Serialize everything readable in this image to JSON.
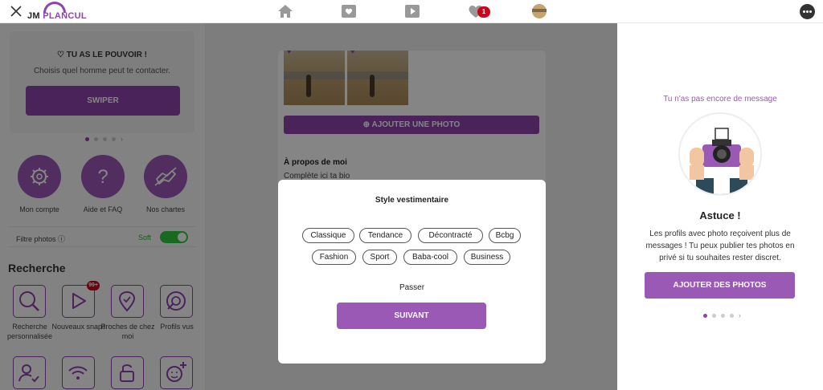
{
  "app": {
    "logo_prefix": "JM",
    "logo_suffix": "PLANCUL",
    "notifications_count": "1"
  },
  "icons": {
    "close": "close-icon",
    "home": "home-icon",
    "cards": "cards-heart-icon",
    "video": "play-icon",
    "likes": "heart-icon",
    "profile": "avatar-icon",
    "chat": "chat-bubble-icon"
  },
  "colors": {
    "brand_purple": "#8e44ad",
    "button_purple": "#9b59b6",
    "toggle_green": "#2ecc40",
    "badge_red": "#d0021b"
  },
  "sidebar": {
    "promo": {
      "title": "TU AS LE POUVOIR !",
      "subtitle": "Choisis quel homme peut te contacter.",
      "button": "SWIPER"
    },
    "quick_actions": [
      {
        "label": "Mon compte",
        "icon": "gear-icon"
      },
      {
        "label": "Aide et FAQ",
        "icon": "question-icon"
      },
      {
        "label": "Nos chartes",
        "icon": "handshake-icon"
      }
    ],
    "filter": {
      "label": "Filtre photos",
      "value": "Soft",
      "enabled": true
    },
    "search": {
      "title": "Recherche",
      "snaps_badge": "99+",
      "items": [
        {
          "label": "Recherche personnalisée",
          "icon": "search-icon"
        },
        {
          "label": "Nouveaux snaps",
          "icon": "play-icon"
        },
        {
          "label": "Proches de chez moi",
          "icon": "location-pin-icon"
        },
        {
          "label": "Profils vus",
          "icon": "eye-icon"
        }
      ]
    }
  },
  "profile": {
    "add_photo_button": "AJOUTER UNE PHOTO",
    "about_title": "À propos de moi",
    "about_placeholder": "Complète ici ta bio"
  },
  "modal": {
    "title": "Style vestimentaire",
    "options_row1": [
      "Classique",
      "Tendance",
      "Décontracté",
      "Bcbg"
    ],
    "options_row2": [
      "Fashion",
      "Sport",
      "Baba-cool",
      "Business"
    ],
    "skip": "Passer",
    "next_button": "SUIVANT"
  },
  "right_panel": {
    "no_message": "Tu n'as pas encore de message",
    "tip_title": "Astuce !",
    "tip_text": "Les profils avec photo reçoivent plus de messages ! Tu peux publier tes photos en privé si tu souhaites rester discret.",
    "button": "AJOUTER DES PHOTOS"
  }
}
